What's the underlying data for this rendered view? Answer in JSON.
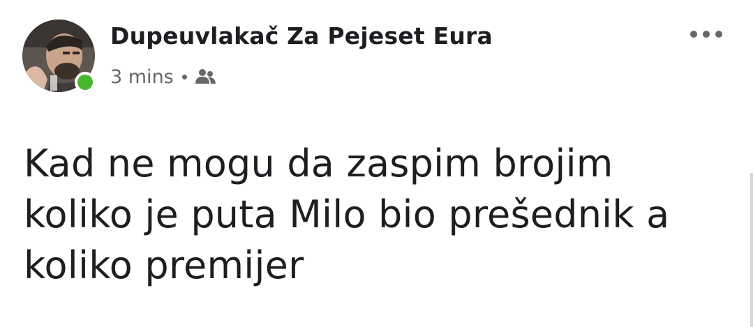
{
  "post": {
    "author_name": "Dupeuvlakač Za Pejeset Eura",
    "timestamp": "3 mins",
    "privacy_icon": "friends-icon",
    "online_status_color": "#44b72f",
    "text": "Kad ne mogu da zaspim brojim\nkoliko je puta Milo bio prešednik a\nkoliko premijer",
    "more_options_icon": "more-options-icon"
  }
}
